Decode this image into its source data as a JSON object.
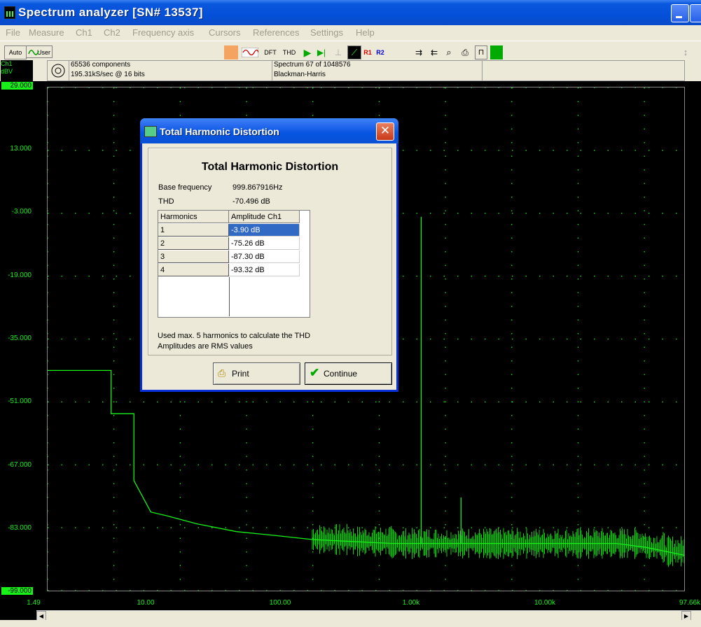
{
  "window": {
    "title": "Spectrum analyzer  [SN# 13537]"
  },
  "menu": [
    "File",
    "Measure",
    "Ch1",
    "Ch2",
    "Frequency axis",
    "Cursors",
    "References",
    "Settings",
    "Help"
  ],
  "toolbar": {
    "auto_label": "Auto",
    "user_label": "User",
    "dft_label": "DFT",
    "thd_label": "THD",
    "r1_label": "R1",
    "r2_label": "R2"
  },
  "info": {
    "components": "65536 components",
    "sample_rate": "195.31kS/sec @ 16 bits",
    "spectrum": "Spectrum 67 of 1048576",
    "window": "Blackman-Harris"
  },
  "channel": {
    "name": "Ch1",
    "unit": "dBV"
  },
  "chart_data": {
    "type": "line",
    "ylabels": [
      "29.000",
      "13.000",
      "-3.000",
      "-19.000",
      "-35.000",
      "-51.000",
      "-67.000",
      "-83.000",
      "-99.000"
    ],
    "xlabels": [
      "1.49",
      "10.00",
      "100.00",
      "1.00k",
      "10.00k",
      "97.66k"
    ],
    "ylim": [
      -99,
      29
    ],
    "xlim_hz": [
      1.49,
      97660
    ],
    "x_scale": "log",
    "grid": true,
    "series": [
      {
        "x": [
          1.49,
          4.5,
          4.5,
          6.7,
          6.7,
          9.0,
          12,
          20,
          40,
          80,
          150,
          300,
          600,
          999.87,
          999.87,
          999.87,
          1200,
          2000,
          2000,
          2000,
          3000,
          5000,
          8000,
          15000,
          30000,
          50000,
          70000,
          97660
        ],
        "y": [
          -43,
          -43,
          -54,
          -54,
          -71,
          -79,
          -80,
          -82,
          -84,
          -85,
          -86,
          -86.5,
          -87,
          -87,
          -3.9,
          -87,
          -87,
          -87,
          -75.3,
          -87,
          -87,
          -87,
          -87,
          -87,
          -87,
          -88,
          -89,
          -90
        ]
      }
    ],
    "colors": {
      "trace": "#19f219",
      "grid": "#19f219",
      "background": "#000000"
    }
  },
  "dialog": {
    "title": "Total Harmonic Distortion",
    "heading": "Total Harmonic Distortion",
    "base_frequency_label": "Base frequency",
    "base_frequency_value": "999.867916Hz",
    "thd_label": "THD",
    "thd_value": "-70.496 dB",
    "table": {
      "headers": [
        "Harmonics",
        "Amplitude Ch1"
      ],
      "rows": [
        [
          "1",
          "-3.90 dB"
        ],
        [
          "2",
          "-75.26 dB"
        ],
        [
          "3",
          "-87.30 dB"
        ],
        [
          "4",
          "-93.32 dB"
        ]
      ]
    },
    "note1": "Used max. 5 harmonics to calculate the THD",
    "note2": "Amplitudes are RMS values",
    "print_label": "Print",
    "continue_label": "Continue",
    "close_glyph": "✕"
  }
}
